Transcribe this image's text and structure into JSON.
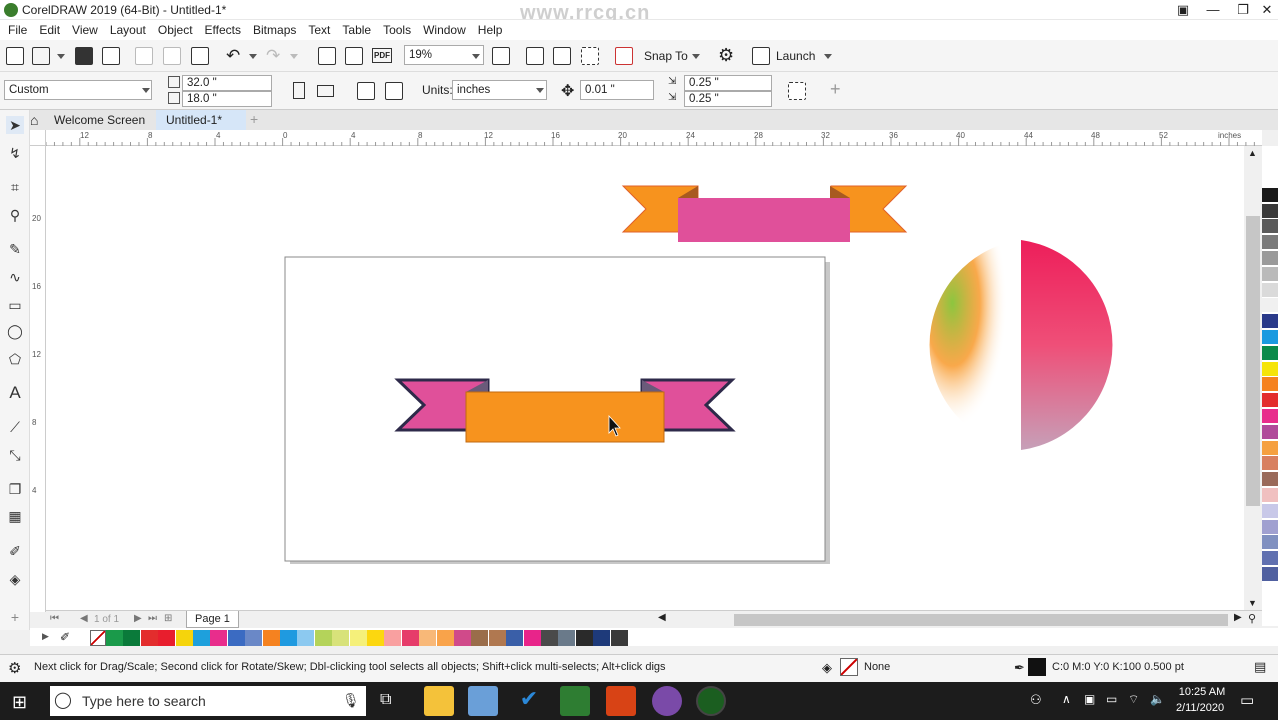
{
  "window": {
    "title": "CorelDRAW 2019 (64-Bit) - Untitled-1*"
  },
  "menu": [
    "File",
    "Edit",
    "View",
    "Layout",
    "Object",
    "Effects",
    "Bitmaps",
    "Text",
    "Table",
    "Tools",
    "Window",
    "Help"
  ],
  "watermark": "www.rrcg.cn",
  "toolbar": {
    "zoom": "19%",
    "snap_to": "Snap To",
    "launch": "Launch"
  },
  "propbar": {
    "preset": "Custom",
    "width": "32.0 \"",
    "height": "18.0 \"",
    "units_label": "Units:",
    "units": "inches",
    "nudge": "0.01 \"",
    "dup_x": "0.25 \"",
    "dup_y": "0.25 \""
  },
  "tabs": {
    "welcome": "Welcome Screen",
    "doc": "Untitled-1*"
  },
  "ruler": {
    "h_ticks": [
      "12",
      "8",
      "4",
      "0",
      "4",
      "8",
      "12",
      "16",
      "20",
      "24",
      "28",
      "32",
      "36",
      "40",
      "44",
      "48",
      "52"
    ],
    "unit": "inches",
    "v_ticks": [
      "20",
      "16",
      "12",
      "8",
      "4"
    ]
  },
  "pagenav": {
    "counter": "1 of 1",
    "page": "Page 1"
  },
  "palette": {
    "bottom": [
      "#1a9a4a",
      "#0a7a3a",
      "#e32d2d",
      "#e81e2d",
      "#f5d40c",
      "#1ea0dc",
      "#e82d8c",
      "#3b6bc2",
      "#6a88c7",
      "#f58220",
      "#1f9ae0",
      "#8cc9f0",
      "#b4d35a",
      "#d8e27a",
      "#f5f07a",
      "#fcd70f",
      "#f9a0a0",
      "#e63c6a",
      "#f8b878",
      "#f9a34a",
      "#d04a8a",
      "#9a6d4a",
      "#b07850",
      "#3a5fa8",
      "#e8248a",
      "#4a4a4a",
      "#6a7a8a",
      "#2a2a2a",
      "#1e3a7a",
      "#3a3a3a"
    ],
    "right": [
      "#ffffff",
      "#1a1a1a",
      "#3a3a3a",
      "#5a5a5a",
      "#7a7a7a",
      "#9a9a9a",
      "#bababa",
      "#dadada",
      "#f0f0f0",
      "#2a3a8a",
      "#1a9ae0",
      "#0a8a4a",
      "#f5e40a",
      "#f58220",
      "#e32d2d",
      "#e82d8c",
      "#b04a9a",
      "#f5a040",
      "#d88060",
      "#9a6a5a",
      "#f0c0c0",
      "#c8c8e8",
      "#a0a0d0",
      "#8090c0",
      "#6070b0",
      "#5060a0"
    ]
  },
  "status": {
    "hint": "Next click for Drag/Scale; Second click for Rotate/Skew; Dbl-clicking tool selects all objects; Shift+click multi-selects; Alt+click digs",
    "fill": "None",
    "outline": "C:0 M:0 Y:0 K:100  0.500 pt"
  },
  "taskbar": {
    "search": "Type here to search",
    "time": "10:25 AM",
    "date": "2/11/2020"
  },
  "colors": {
    "pink": "#e0509a",
    "orange": "#f7931e",
    "dark": "#2e2a4a"
  }
}
